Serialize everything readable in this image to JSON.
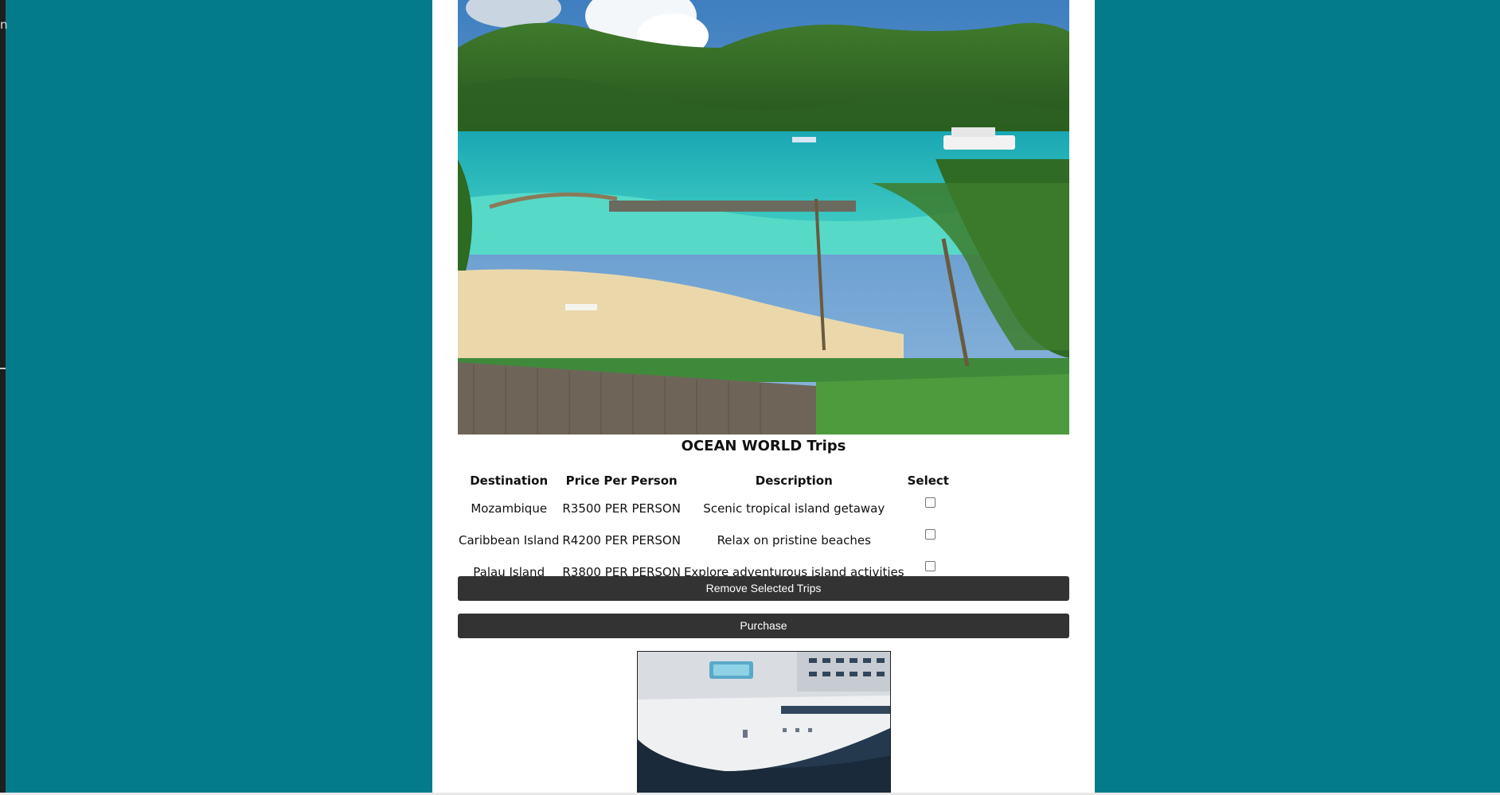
{
  "left_edge": {
    "glyph": "n"
  },
  "trips": {
    "title": "OCEAN WORLD Trips",
    "columns": [
      "Destination",
      "Price Per Person",
      "Description",
      "Select"
    ],
    "rows": [
      {
        "destination": "Mozambique",
        "price": "R3500 PER PERSON",
        "description": "Scenic tropical island getaway",
        "selected": false
      },
      {
        "destination": "Caribbean Island",
        "price": "R4200 PER PERSON",
        "description": "Relax on pristine beaches",
        "selected": false
      },
      {
        "destination": "Palau Island",
        "price": "R3800 PER PERSON",
        "description": "Explore adventurous island activities",
        "selected": false
      }
    ]
  },
  "buttons": {
    "remove_label": "Remove Selected Trips",
    "purchase_label": "Purchase"
  },
  "colors": {
    "background": "#037b8b",
    "button": "#333333",
    "page": "#ffffff"
  }
}
